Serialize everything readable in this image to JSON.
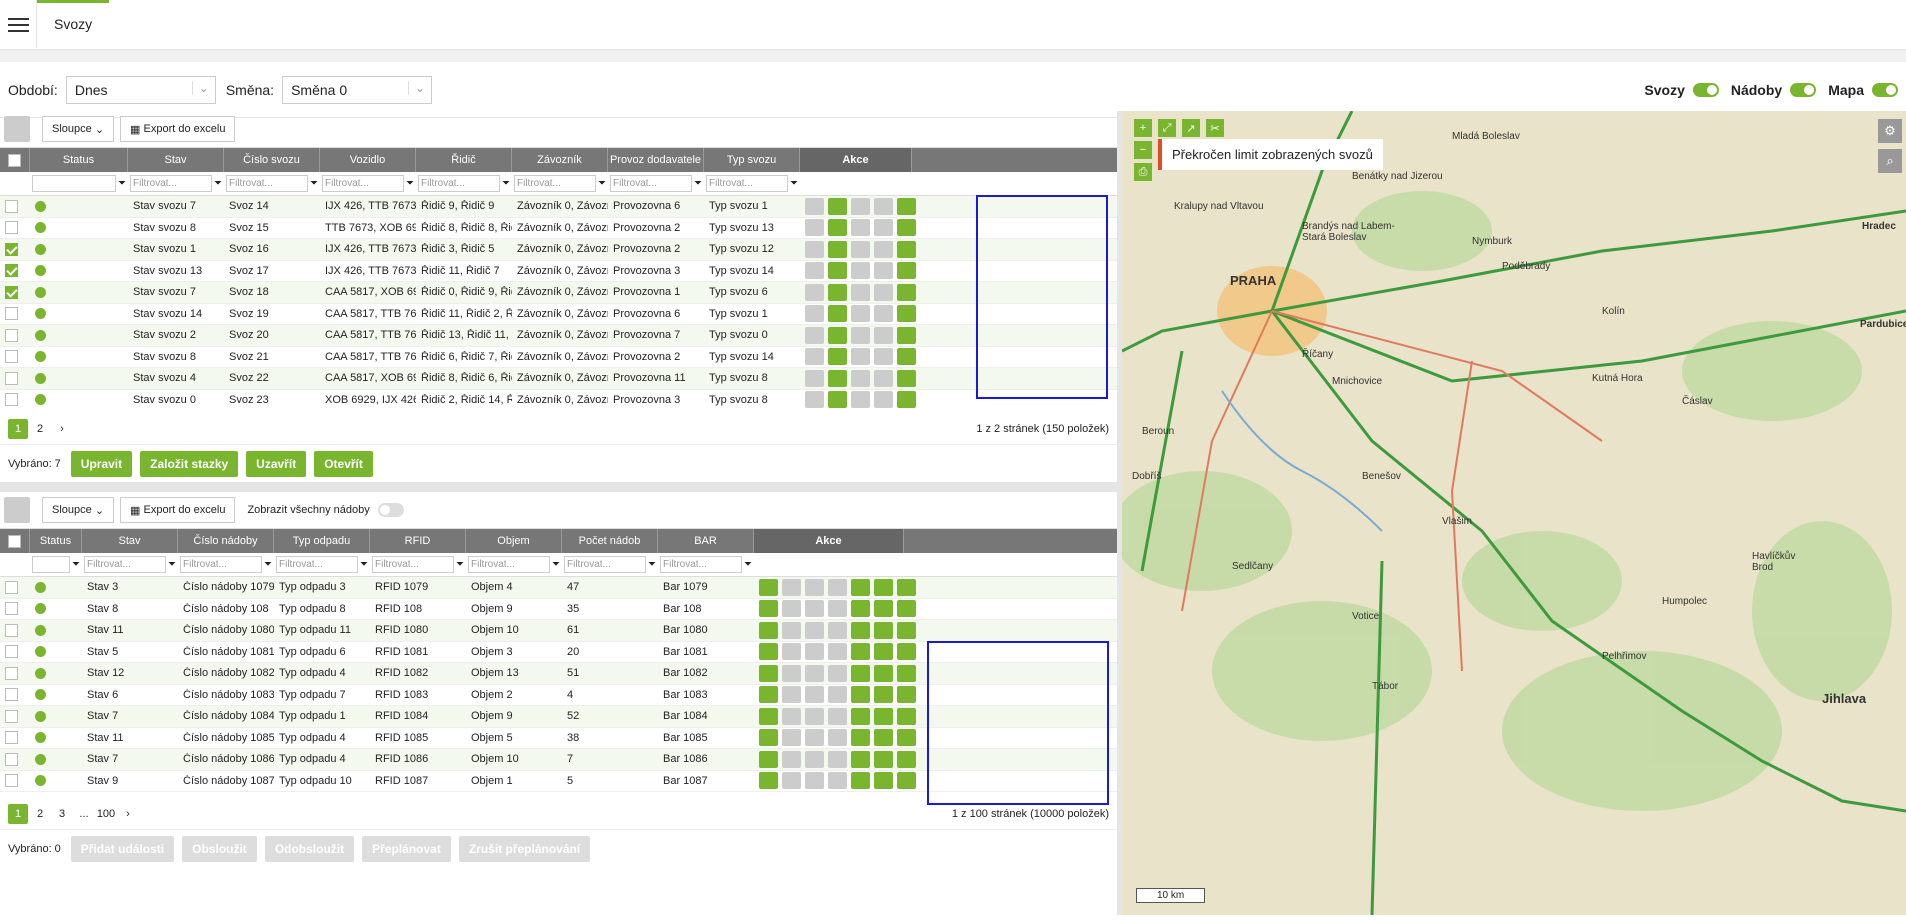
{
  "header": {
    "tab": "Svozy"
  },
  "filters": {
    "period_label": "Období:",
    "period_value": "Dnes",
    "shift_label": "Směna:",
    "shift_value": "Směna 0"
  },
  "toggles": [
    {
      "label": "Svozy"
    },
    {
      "label": "Nádoby"
    },
    {
      "label": "Mapa"
    }
  ],
  "top": {
    "columns_btn": "Sloupce",
    "export_btn": "Export do excelu",
    "headers": [
      "Status",
      "Stav",
      "Číslo svozu",
      "Vozidlo",
      "Řidič",
      "Závozník",
      "Provoz dodavatele",
      "Typ svozu",
      "Akce"
    ],
    "filter_placeholder": "Filtrovat...",
    "rows": [
      [
        "Stav svozu 7",
        "Svoz 14",
        "IJX 426, TTB 7673",
        "Řidič 9, Řidič 9",
        "Závozník 0, Závozní...",
        "Provozovna 6",
        "Typ svozu 1"
      ],
      [
        "Stav svozu 8",
        "Svoz 15",
        "TTB 7673, XOB 692...",
        "Řidič 8, Řidič 8, Řidič...",
        "Závozník 0, Závozní...",
        "Provozovna 2",
        "Typ svozu 13"
      ],
      [
        "Stav svozu 1",
        "Svoz 16",
        "IJX 426, TTB 7673",
        "Řidič 3, Řidič 5",
        "Závozník 0, Závozní...",
        "Provozovna 2",
        "Typ svozu 12"
      ],
      [
        "Stav svozu 13",
        "Svoz 17",
        "IJX 426, TTB 7673",
        "Řidič 11, Řidič 7",
        "Závozník 0, Závozní...",
        "Provozovna 3",
        "Typ svozu 14"
      ],
      [
        "Stav svozu 7",
        "Svoz 18",
        "CAA 5817, XOB 692...",
        "Řidič 0, Řidič 9, Řidič...",
        "Závozník 0, Závozní...",
        "Provozovna 1",
        "Typ svozu 6"
      ],
      [
        "Stav svozu 14",
        "Svoz 19",
        "CAA 5817, TTB 767...",
        "Řidič 11, Řidič 2, Řid...",
        "Závozník 0, Závozní...",
        "Provozovna 6",
        "Typ svozu 1"
      ],
      [
        "Stav svozu 2",
        "Svoz 20",
        "CAA 5817, TTB 767...",
        "Řidič 13, Řidič 11, Ři...",
        "Závozník 0, Závozní...",
        "Provozovna 7",
        "Typ svozu 0"
      ],
      [
        "Stav svozu 8",
        "Svoz 21",
        "CAA 5817, TTB 767...",
        "Řidič 6, Řidič 7, Řidič...",
        "Závozník 0, Závozní...",
        "Provozovna 2",
        "Typ svozu 14"
      ],
      [
        "Stav svozu 4",
        "Svoz 22",
        "CAA 5817, XOB 692...",
        "Řidič 8, Řidič 6, Řidič...",
        "Závozník 0, Závozní...",
        "Provozovna 11",
        "Typ svozu 8"
      ],
      [
        "Stav svozu 0",
        "Svoz 23",
        "XOB 6929, IJX 426, ...",
        "Řidič 2, Řidič 14, Řid...",
        "Závozník 0, Závozní...",
        "Provozovna 3",
        "Typ svozu 8"
      ]
    ],
    "checked": [
      false,
      false,
      true,
      true,
      true,
      false,
      false,
      false,
      false,
      false
    ],
    "pages": [
      "1",
      "2"
    ],
    "page_info": "1 z 2 stránek (150 položek)",
    "selected": "Vybráno: 7",
    "actions": [
      "Upravit",
      "Založit stazky",
      "Uzavřít",
      "Otevřít"
    ]
  },
  "bottom": {
    "columns_btn": "Sloupce",
    "export_btn": "Export do excelu",
    "show_all": "Zobrazit všechny nádoby",
    "headers": [
      "Status",
      "Stav",
      "Číslo nádoby",
      "Typ odpadu",
      "RFID",
      "Objem",
      "Počet nádob",
      "BAR",
      "Akce"
    ],
    "rows": [
      [
        "Stav 3",
        "Číslo nádoby 1079",
        "Typ odpadu 3",
        "RFID 1079",
        "Objem 4",
        "47",
        "Bar 1079"
      ],
      [
        "Stav 8",
        "Číslo nádoby 108",
        "Typ odpadu 8",
        "RFID 108",
        "Objem 9",
        "35",
        "Bar 108"
      ],
      [
        "Stav 11",
        "Číslo nádoby 1080",
        "Typ odpadu 11",
        "RFID 1080",
        "Objem 10",
        "61",
        "Bar 1080"
      ],
      [
        "Stav 5",
        "Číslo nádoby 1081",
        "Typ odpadu 6",
        "RFID 1081",
        "Objem 3",
        "20",
        "Bar 1081"
      ],
      [
        "Stav 12",
        "Číslo nádoby 1082",
        "Typ odpadu 4",
        "RFID 1082",
        "Objem 13",
        "51",
        "Bar 1082"
      ],
      [
        "Stav 6",
        "Číslo nádoby 1083",
        "Typ odpadu 7",
        "RFID 1083",
        "Objem 2",
        "4",
        "Bar 1083"
      ],
      [
        "Stav 7",
        "Číslo nádoby 1084",
        "Typ odpadu 1",
        "RFID 1084",
        "Objem 9",
        "52",
        "Bar 1084"
      ],
      [
        "Stav 11",
        "Číslo nádoby 1085",
        "Typ odpadu 4",
        "RFID 1085",
        "Objem 5",
        "38",
        "Bar 1085"
      ],
      [
        "Stav 7",
        "Číslo nádoby 1086",
        "Typ odpadu 4",
        "RFID 1086",
        "Objem 10",
        "7",
        "Bar 1086"
      ],
      [
        "Stav 9",
        "Číslo nádoby 1087",
        "Typ odpadu 10",
        "RFID 1087",
        "Objem 1",
        "5",
        "Bar 1087"
      ]
    ],
    "pages": [
      "1",
      "2",
      "3",
      "...",
      "100"
    ],
    "page_info": "1 z 100 stránek (10000 položek)",
    "selected": "Vybráno: 0",
    "actions": [
      "Přidat události",
      "Obsloužit",
      "Odobsloužit",
      "Přeplánovat",
      "Zrušit přeplánování"
    ]
  },
  "map": {
    "notice": "Překročen limit zobrazených svozů",
    "scale": "10 km",
    "cities": [
      "PRAHA",
      "Kralupy nad Vltavou",
      "Brandýs nad Labem-Stará Boleslav",
      "Benátky nad Jizerou",
      "Mladá Boleslav",
      "Nymburk",
      "Říčany",
      "Beroun",
      "Benešov",
      "Vlašim",
      "Sedlčany",
      "Tábor",
      "Jihlava",
      "Kutná Hora",
      "Kolín",
      "Čáslav",
      "Pardubice",
      "Hradec",
      "Humpolec",
      "Pelhřimov",
      "Havlíčkův Brod",
      "Votice",
      "Poděbrady",
      "Mnichovice",
      "Dobříš"
    ]
  }
}
